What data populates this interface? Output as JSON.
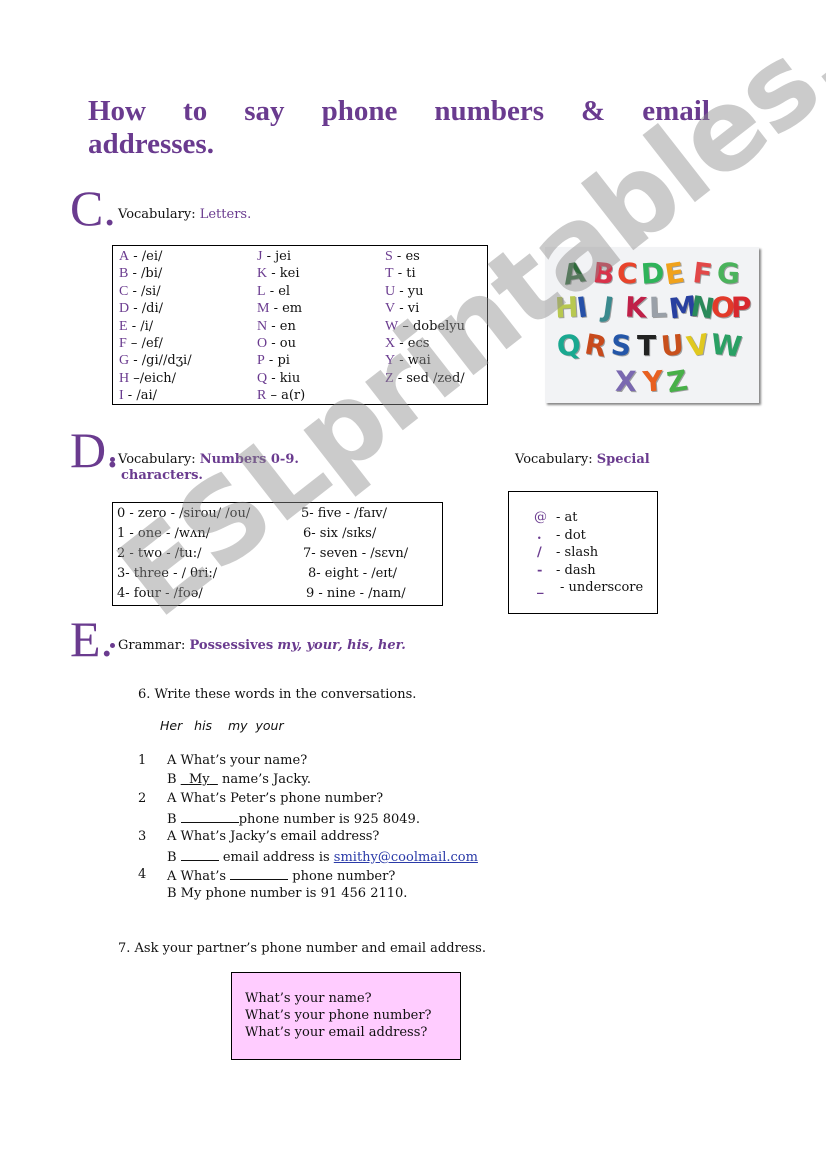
{
  "title": {
    "line1_words": [
      "How",
      "to",
      "say",
      "phone",
      "numbers",
      "&",
      "email"
    ],
    "line2": "addresses."
  },
  "section_c": {
    "letter": "C.",
    "label": "Vocabulary:",
    "keyword": "Letters.",
    "alphabet": [
      [
        {
          "ch": "A",
          "pron": " - /ei/"
        },
        {
          "ch": "B",
          "pron": " - /bi/"
        },
        {
          "ch": "C",
          "pron": " - /si/"
        },
        {
          "ch": "D",
          "pron": " - /di/"
        },
        {
          "ch": "E",
          "pron": " - /i/"
        },
        {
          "ch": "F",
          "pron": " – /ef/"
        },
        {
          "ch": "G",
          "pron": " - /gi//dʒi/"
        },
        {
          "ch": "H",
          "pron": " –/eich/"
        },
        {
          "ch": " I",
          "pron": " -  /ai/"
        }
      ],
      [
        {
          "ch": "J",
          "pron": " - jei"
        },
        {
          "ch": "K",
          "pron": " - kei"
        },
        {
          "ch": "L",
          "pron": " - el"
        },
        {
          "ch": "M",
          "pron": " - em"
        },
        {
          "ch": "N",
          "pron": " - en"
        },
        {
          "ch": "O",
          "pron": " - ou"
        },
        {
          "ch": "P",
          "pron": " - pi"
        },
        {
          "ch": "Q",
          "pron": " - kiu"
        },
        {
          "ch": "R",
          "pron": " – a(r)"
        }
      ],
      [
        {
          "ch": "S",
          "pron": " - es"
        },
        {
          "ch": "T",
          "pron": " - ti"
        },
        {
          "ch": "U",
          "pron": " - yu"
        },
        {
          "ch": "V",
          "pron": " - vi"
        },
        {
          "ch": "W",
          "pron": " – dobelyu"
        },
        {
          "ch": "X",
          "pron": " - ecs"
        },
        {
          "ch": "Y",
          "pron": " - wai"
        },
        {
          "ch": "Z",
          "pron": " - sed /zed/"
        }
      ]
    ],
    "image_letters": [
      [
        "A",
        "B",
        "C",
        "D",
        "E",
        "F",
        "G"
      ],
      [
        "H",
        "I",
        "J",
        "K",
        "L",
        "M",
        "N",
        "O",
        "P"
      ],
      [
        "Q",
        "R",
        "S",
        "T",
        "U",
        "V",
        "W"
      ],
      [
        "X",
        "Y",
        "Z"
      ]
    ]
  },
  "section_d": {
    "letter": "D.",
    "label": "Vocabulary:",
    "keyword": "Numbers 0-9.",
    "numbers": [
      "0 - zero - /sirou/ /ou/",
      "1 - one - /wʌn/",
      "2 - two - /tu:/",
      "3- three - / θri:/",
      "4- four - /foə/",
      "5- five - /faɪv/",
      "6- six /sɪks/",
      "7- seven - /sɛvn/",
      "8- eight - /eɪt/",
      "9 - nine - /naɪn/"
    ],
    "special_label": "Vocabulary:",
    "special_keyword": "Special",
    "special_keyword_cont": "characters.",
    "special_chars": [
      {
        "sym": "@",
        "name": "-  at"
      },
      {
        "sym": ".",
        "name": "- dot"
      },
      {
        "sym": "/",
        "name": "- slash"
      },
      {
        "sym": "-",
        "name": "- dash"
      },
      {
        "sym": "_",
        "name": "- underscore"
      }
    ]
  },
  "section_e": {
    "letter": "E.",
    "label": "Grammar:",
    "keyword": "Possessives",
    "keyword_italic": "my, your, his, her.",
    "exercise6": {
      "instruction": "6. Write these words in the conversations.",
      "word_bank": [
        "Her",
        "his",
        "my",
        "your"
      ],
      "items": [
        {
          "num": "1",
          "a": "A What’s your name?",
          "b_pre": "B ",
          "b_fill": "My",
          "b_post": " name’s Jacky."
        },
        {
          "num": "2",
          "a": "A What’s Peter’s phone number?",
          "b_pre": "B ",
          "b_fill": "",
          "b_post": "phone number is 925 8049."
        },
        {
          "num": "3",
          "a": "A What’s Jacky’s email address?",
          "b_pre": "B ",
          "b_fill": "",
          "b_post": " email address is ",
          "b_link": "smithy@coolmail.com"
        },
        {
          "num": "4",
          "a_pre": "A What’s ",
          "a_post": " phone number?",
          "b": "B My phone number is 91 456 2110."
        }
      ]
    },
    "exercise7": {
      "instruction": "7.  Ask your partner’s phone number and email address.",
      "questions": [
        "What’s your name?",
        " What’s your phone number?",
        " What’s your email address?"
      ]
    }
  },
  "watermark": "ESLprintables.com",
  "colors": {
    "accent_purple": "#6a3b8f",
    "pink_box": "#ffccff",
    "link_blue": "#2a3aa8"
  }
}
